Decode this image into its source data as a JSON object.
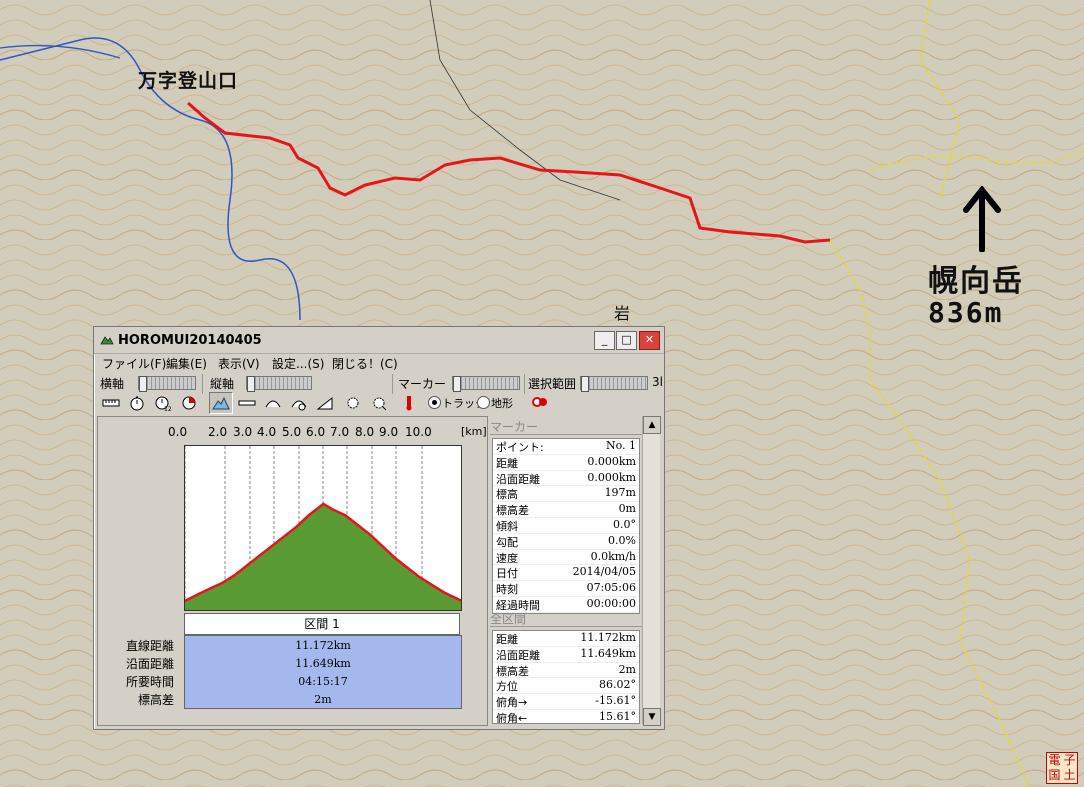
{
  "map": {
    "trail_start_label": "万字登山口",
    "peak_name": "幌向岳",
    "peak_elevation": "836m",
    "rock_label": "岩",
    "stamp_chars": [
      "電",
      "子",
      "国",
      "土"
    ],
    "track_color": "#e8141b",
    "background_color": "#cfc8b4"
  },
  "window": {
    "title": "HOROMUI20140405",
    "title_buttons": {
      "minimize": "_",
      "maximize": "□",
      "close": "✕"
    },
    "menu": [
      "ファイル(F)",
      "編集(E)",
      "表示(V)",
      "設定...(S)",
      "閉じる！(C)"
    ],
    "toolbar1": {
      "horizontal_axis": "横軸",
      "vertical_axis": "縦軸",
      "marker": "マーカー",
      "selection_range": "選択範囲",
      "cut_off": "3l"
    },
    "toolbar2": {
      "icons": [
        "ruler-icon",
        "stopwatch-icon",
        "stopwatch-123-icon",
        "pie-icon",
        "mountain-profile-icon",
        "horizontal-ruler-icon",
        "arc-icon",
        "speed-meter-icon",
        "slope-icon",
        "gear-cursor-icon",
        "gear-cursor-alt-icon",
        "thermometer-icon",
        "marker-pin-icon"
      ],
      "radio_track": "トラック",
      "radio_terrain": "地形",
      "radio_selected": "track"
    },
    "graph": {
      "x_ticks": [
        "0.0",
        "2.0",
        "3.0",
        "4.0",
        "5.0",
        "6.0",
        "7.0",
        "8.0",
        "9.0",
        "10.0"
      ],
      "unit": "[km]",
      "section_header": "区間 1",
      "summary_labels": [
        "直線距離",
        "沿面距離",
        "所要時間",
        "標高差"
      ],
      "summary_values": [
        "11.172km",
        "11.649km",
        "04:15:17",
        "2m"
      ]
    },
    "marker_panel": {
      "title": "マーカー",
      "rows": [
        {
          "k": "ポイント:",
          "v": "No. 1"
        },
        {
          "k": "距離",
          "v": "0.000km"
        },
        {
          "k": "沿面距離",
          "v": "0.000km"
        },
        {
          "k": "標高",
          "v": "197m"
        },
        {
          "k": "標高差",
          "v": "0m"
        },
        {
          "k": "傾斜",
          "v": "0.0°"
        },
        {
          "k": "勾配",
          "v": "0.0%"
        },
        {
          "k": "速度",
          "v": "0.0km/h"
        },
        {
          "k": "日付",
          "v": "2014/04/05"
        },
        {
          "k": "時刻",
          "v": "07:05:06"
        },
        {
          "k": "経過時間",
          "v": "00:00:00"
        }
      ]
    },
    "total_panel": {
      "title": "全区間",
      "rows": [
        {
          "k": "距離",
          "v": "11.172km"
        },
        {
          "k": "沿面距離",
          "v": "11.649km"
        },
        {
          "k": "標高差",
          "v": "2m"
        },
        {
          "k": "方位",
          "v": "86.02°"
        },
        {
          "k": "俯角→",
          "v": "-15.61°"
        },
        {
          "k": "俯角←",
          "v": "15.61°"
        }
      ]
    }
  },
  "chart_data": {
    "type": "area",
    "title": "",
    "xlabel": "[km]",
    "ylabel": "",
    "xlim": [
      0,
      11.172
    ],
    "x": [
      0,
      0.5,
      1,
      1.5,
      2,
      2.5,
      3,
      3.5,
      4,
      4.5,
      5,
      5.5,
      5.6,
      6,
      6.5,
      7,
      7.5,
      8,
      8.5,
      9,
      9.5,
      10,
      10.5,
      11.172
    ],
    "values": [
      197,
      230,
      260,
      290,
      330,
      380,
      430,
      480,
      530,
      580,
      640,
      690,
      700,
      670,
      640,
      590,
      540,
      480,
      420,
      370,
      320,
      280,
      240,
      199
    ],
    "series": [
      {
        "values_ref": "values",
        "color": "#e8141b",
        "fill": "#5a9a33"
      }
    ]
  }
}
